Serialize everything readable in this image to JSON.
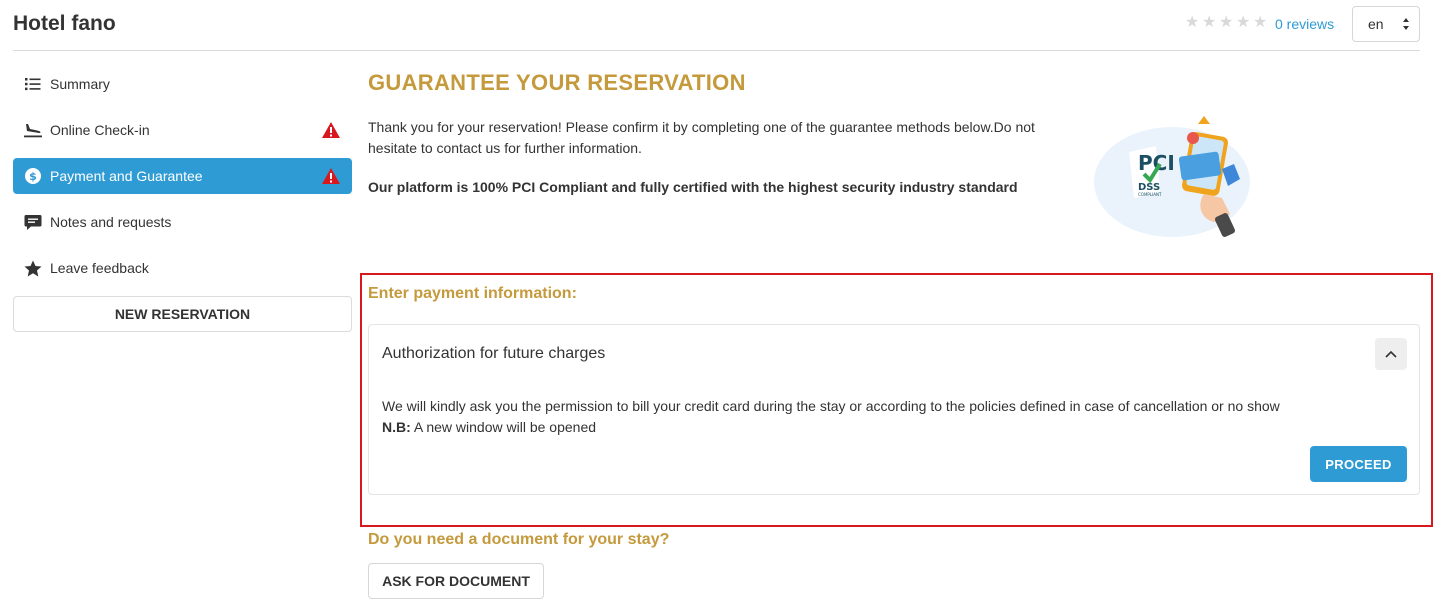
{
  "header": {
    "hotel_name": "Hotel fano",
    "rating_stars": 0,
    "reviews_label": "0 reviews",
    "language": "en"
  },
  "sidebar": {
    "items": [
      {
        "label": "Summary",
        "icon": "list-icon",
        "active": false,
        "warning": false
      },
      {
        "label": "Online Check-in",
        "icon": "plane-landing-icon",
        "active": false,
        "warning": true
      },
      {
        "label": "Payment and Guarantee",
        "icon": "dollar-circle-icon",
        "active": true,
        "warning": true
      },
      {
        "label": "Notes and requests",
        "icon": "comment-icon",
        "active": false,
        "warning": false
      },
      {
        "label": "Leave feedback",
        "icon": "star-icon",
        "active": false,
        "warning": false
      }
    ],
    "new_reservation_label": "NEW RESERVATION"
  },
  "main": {
    "title": "GUARANTEE YOUR RESERVATION",
    "intro": "Thank you for your reservation! Please confirm it by completing one of the guarantee methods below.Do not hesitate to contact us for further information.",
    "pci_statement": "Our platform is 100% PCI Compliant and fully certified with the highest security industry standard",
    "pci_logo_text": "PCI",
    "pci_logo_sub": "DSS",
    "pci_logo_caption": "COMPLIANT",
    "payment_section_title": "Enter payment information:",
    "auth_card": {
      "title": "Authorization for future charges",
      "description": "We will kindly ask you the permission to bill your credit card during the stay or according to the policies defined in case of cancellation or no show",
      "nb_label": "N.B:",
      "nb_text": " A new window will be opened",
      "proceed_label": "PROCEED"
    },
    "document_section_title": "Do you need a document for your stay?",
    "ask_document_label": "ASK FOR DOCUMENT"
  },
  "colors": {
    "accent_blue": "#2f9bd4",
    "gold_heading": "#c49a3c",
    "warning_red": "#d7191f"
  }
}
